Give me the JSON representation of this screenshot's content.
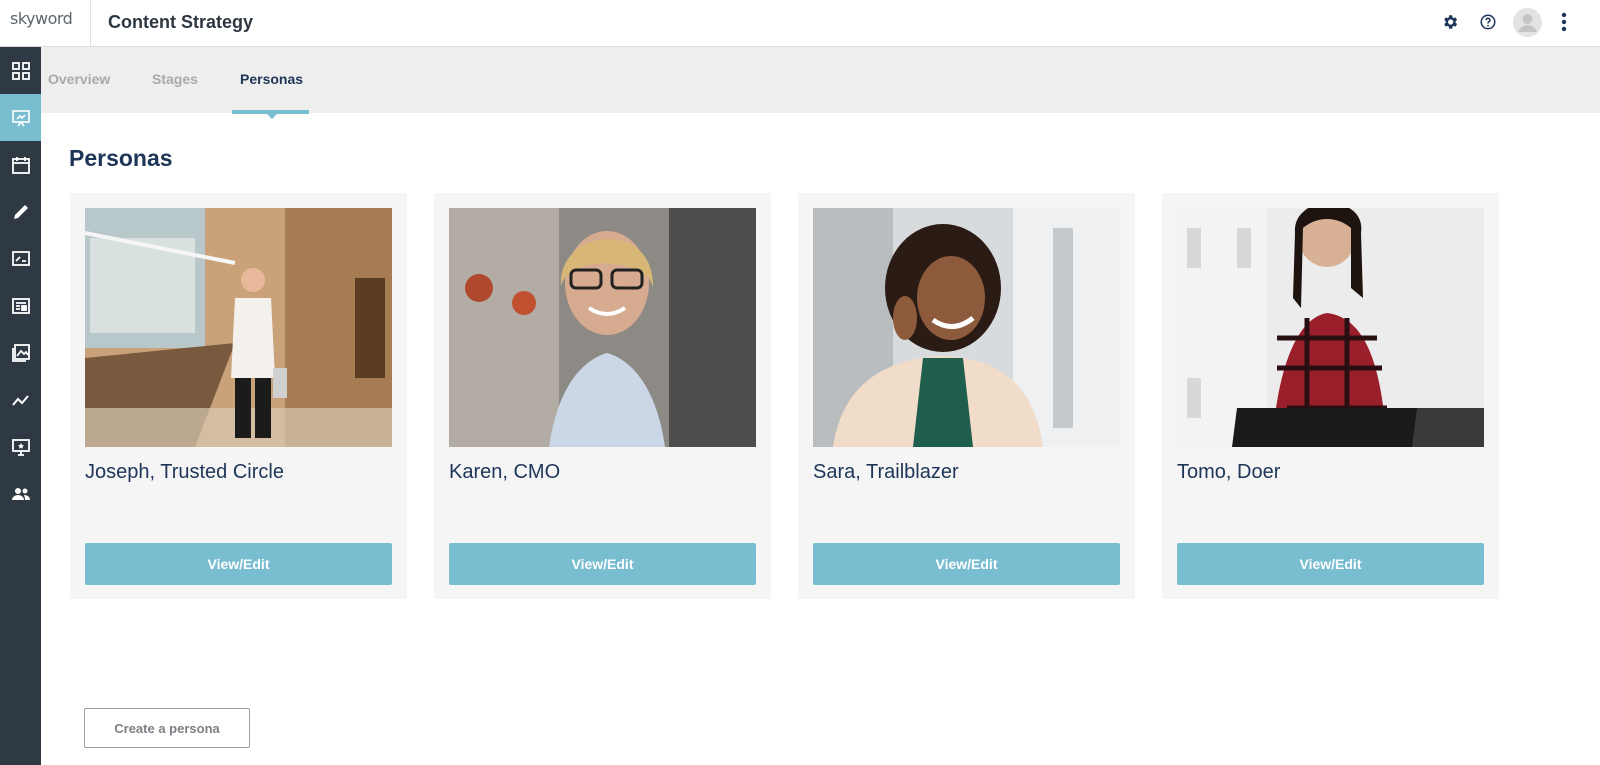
{
  "header": {
    "logo_text": "skyword",
    "title": "Content Strategy",
    "icons": [
      "gear-icon",
      "help-icon",
      "avatar",
      "more-vertical-icon"
    ]
  },
  "sidebar": {
    "items": [
      {
        "icon": "dashboard-grid-icon",
        "active": false
      },
      {
        "icon": "presentation-icon",
        "active": true
      },
      {
        "icon": "calendar-icon",
        "active": false
      },
      {
        "icon": "pencil-icon",
        "active": false
      },
      {
        "icon": "signature-icon",
        "active": false
      },
      {
        "icon": "document-icon",
        "active": false
      },
      {
        "icon": "image-gallery-icon",
        "active": false
      },
      {
        "icon": "analytics-icon",
        "active": false
      },
      {
        "icon": "screen-star-icon",
        "active": false
      },
      {
        "icon": "people-icon",
        "active": false
      }
    ],
    "accent_color": "#79bdd1"
  },
  "tabs": [
    {
      "label": "Overview",
      "active": false
    },
    {
      "label": "Stages",
      "active": false
    },
    {
      "label": "Personas",
      "active": true
    }
  ],
  "page": {
    "title": "Personas",
    "create_button_label": "Create a persona"
  },
  "personas": [
    {
      "name": "Joseph, Trusted Circle",
      "button_label": "View/Edit"
    },
    {
      "name": "Karen, CMO",
      "button_label": "View/Edit"
    },
    {
      "name": "Sara, Trailblazer",
      "button_label": "View/Edit"
    },
    {
      "name": "Tomo, Doer",
      "button_label": "View/Edit"
    }
  ]
}
